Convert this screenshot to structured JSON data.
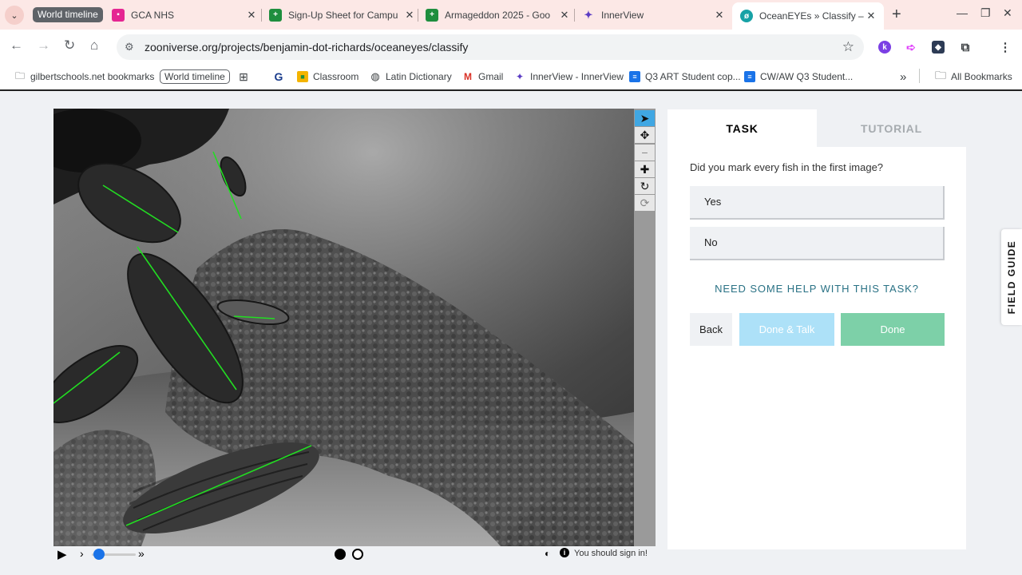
{
  "browser": {
    "tab_search_icon": "chevron-down-icon",
    "group_label": "World timeline",
    "tabs": [
      {
        "title": "GCA NHS",
        "favicon_color": "#e52592",
        "favicon": "calendar-icon"
      },
      {
        "title": "Sign-Up Sheet for Campu",
        "favicon_color": "#1e8e3e",
        "favicon": "sheets-icon"
      },
      {
        "title": "Armageddon 2025 - Goo",
        "favicon_color": "#1e8e3e",
        "favicon": "sheets-icon"
      },
      {
        "title": "InnerView",
        "favicon_color": "#5b3cc4",
        "favicon": "innerview-icon"
      },
      {
        "title": "OceanEYEs » Classify – Z",
        "favicon_color": "#17a2a6",
        "favicon": "zooniverse-icon",
        "active": true
      }
    ],
    "new_tab": "+",
    "url": "zooniverse.org/projects/benjamin-dot-richards/oceaneyes/classify",
    "bookmarks": [
      {
        "label": "gilbertschools.net bookmarks",
        "icon": "managed-folder-icon"
      },
      {
        "label": "World timeline",
        "icon": "",
        "chip": true
      },
      {
        "label": "",
        "icon": "apps-grid-icon"
      },
      {
        "label": "",
        "icon": "g-logo-icon"
      },
      {
        "label": "Classroom",
        "icon": "classroom-icon"
      },
      {
        "label": "Latin Dictionary",
        "icon": "globe-icon"
      },
      {
        "label": "Gmail",
        "icon": "gmail-icon"
      },
      {
        "label": "InnerView - InnerView",
        "icon": "innerview-icon"
      },
      {
        "label": "Q3 ART Student cop...",
        "icon": "docs-icon"
      },
      {
        "label": "CW/AW Q3 Student...",
        "icon": "docs-icon"
      }
    ],
    "more_bookmarks": "»",
    "all_bookmarks": "All Bookmarks"
  },
  "viewer": {
    "tools": [
      "pointer-icon",
      "move-icon",
      "zoom-out-icon",
      "zoom-in-icon",
      "rotate-icon",
      "reset-icon"
    ],
    "sign_in_text": "You should sign in!"
  },
  "task_panel": {
    "tab_task": "TASK",
    "tab_tutorial": "TUTORIAL",
    "question": "Did you mark every fish in the first image?",
    "answers": [
      "Yes",
      "No"
    ],
    "help_link": "NEED SOME HELP WITH THIS TASK?",
    "back_label": "Back",
    "done_talk_label": "Done & Talk",
    "done_label": "Done"
  },
  "field_guide_label": "FIELD GUIDE",
  "colors": {
    "marker": "#22dd22",
    "done": "#7dd0a8",
    "done_talk": "#ade1f8",
    "help": "#2a7285",
    "tab_bar": "#fce8e6"
  }
}
